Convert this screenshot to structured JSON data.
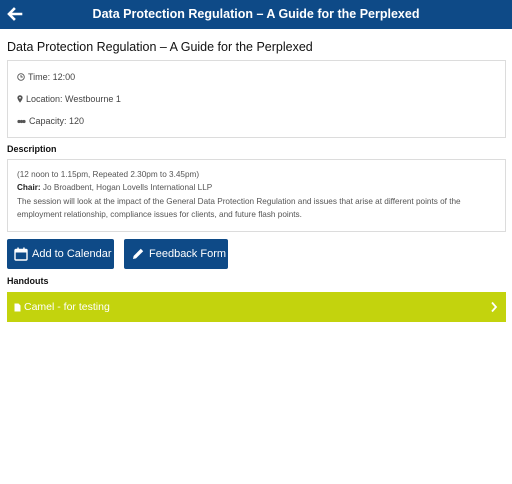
{
  "header": {
    "title": "Data Protection Regulation – A Guide for the Perplexed",
    "back_icon": "arrow-left-icon"
  },
  "session": {
    "title": "Data Protection Regulation – A Guide for the Perplexed",
    "time": "Time: 12:00",
    "location": "Location: Westbourne 1",
    "capacity": "Capacity: 120"
  },
  "description": {
    "label": "Description",
    "line1": "(12 noon to 1.15pm, Repeated 2.30pm to 3.45pm)",
    "chair_label": "Chair:",
    "chair_value": " Jo Broadbent, Hogan Lovells International LLP",
    "body": "The session will look at the impact of the General Data Protection Regulation and issues that arise at different points of the employment relationship, compliance issues for clients, and future flash points."
  },
  "actions": {
    "calendar_label": "Add to Calendar",
    "feedback_label": "Feedback Form"
  },
  "handouts": {
    "label": "Handouts",
    "items": [
      {
        "label": "Camel - for testing"
      }
    ]
  },
  "colors": {
    "header_bg": "#0e4a87",
    "button_bg": "#0e4a87",
    "handout_bg": "#c3d30d"
  }
}
